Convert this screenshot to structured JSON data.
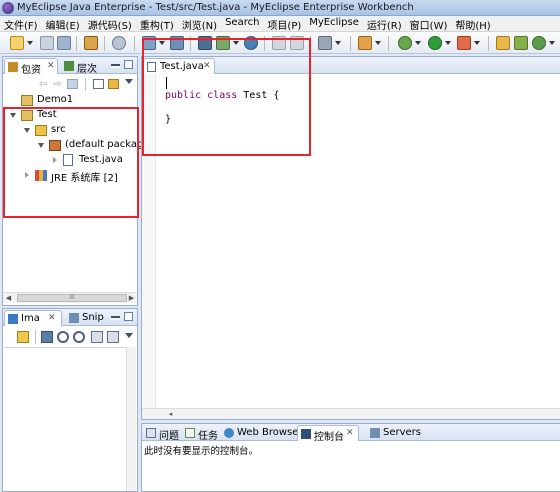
{
  "window": {
    "title": "MyEclipse Java Enterprise - Test/src/Test.java - MyEclipse Enterprise Workbench"
  },
  "menu": [
    "文件(F)",
    "编辑(E)",
    "源代码(S)",
    "重构(T)",
    "浏览(N)",
    "Search",
    "项目(P)",
    "MyEclipse",
    "运行(R)",
    "窗口(W)",
    "帮助(H)"
  ],
  "package_explorer": {
    "tabs": [
      {
        "label": "包资"
      },
      {
        "label": "层次"
      }
    ],
    "tree": [
      {
        "label": "Demo1",
        "icon": "project-icon"
      },
      {
        "label": "Test",
        "icon": "project-icon"
      },
      {
        "label": "src",
        "icon": "source-folder-icon"
      },
      {
        "label": "(default package",
        "icon": "package-icon"
      },
      {
        "label": "Test.java",
        "icon": "java-file-icon"
      },
      {
        "label": "JRE 系统库 [2]",
        "icon": "library-icon"
      }
    ],
    "hscroll_label": "III"
  },
  "image_panel": {
    "tabs": [
      {
        "label": "Ima"
      },
      {
        "label": "Snip"
      }
    ]
  },
  "editor": {
    "tab_label": "Test.java",
    "code": [
      {
        "kw1": "public",
        "kw2": "class",
        "rest": " Test {"
      },
      {
        "text": "}"
      }
    ]
  },
  "console": {
    "tabs": [
      {
        "label": "问题"
      },
      {
        "label": "任务"
      },
      {
        "label": "Web Browser"
      },
      {
        "label": "控制台"
      },
      {
        "label": "Servers"
      }
    ],
    "message": "此时没有要显示的控制台。"
  },
  "colors": {
    "highlight": "#e8232b",
    "keyword": "#7f0055"
  }
}
